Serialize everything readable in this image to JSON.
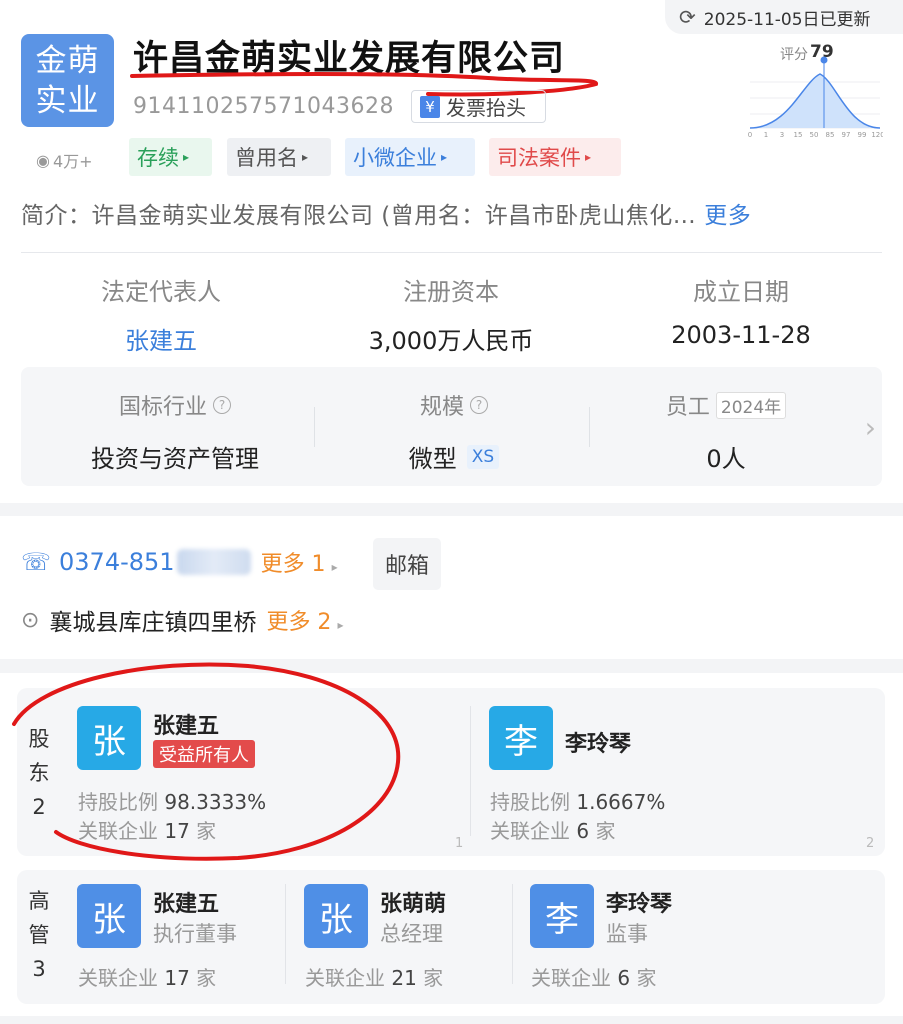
{
  "update": {
    "icon": "refresh-icon",
    "text": "2025-11-05日已更新"
  },
  "company": {
    "logo_line1": "金萌",
    "logo_line2": "实业",
    "name": "许昌金萌实业发展有限公司",
    "credit_code": "914110257571043628",
    "invoice_label": "发票抬头",
    "views": "4万+"
  },
  "score": {
    "label": "评分",
    "value": "79",
    "axis": [
      "0",
      "1",
      "3",
      "15",
      "50",
      "85",
      "97",
      "99",
      "120"
    ]
  },
  "tags": [
    {
      "label": "存续",
      "color": "#2aa05a"
    },
    {
      "label": "曾用名",
      "color": "#555555"
    },
    {
      "label": "小微企业",
      "color": "#3b7fdb"
    },
    {
      "label": "司法案件",
      "color": "#e04a4a"
    }
  ],
  "intro": {
    "prefix": "简介：",
    "text": "许昌金萌实业发展有限公司 (曾用名：许昌市卧虎山焦化…",
    "more": "更多"
  },
  "stats": [
    {
      "label": "法定代表人",
      "value": "张建五"
    },
    {
      "label": "注册资本",
      "value": "3,000万人民币"
    },
    {
      "label": "成立日期",
      "value": "2003-11-28"
    }
  ],
  "info": {
    "industry": {
      "label": "国标行业",
      "value": "投资与资产管理"
    },
    "scale": {
      "label": "规模",
      "value": "微型",
      "badge": "XS"
    },
    "staff": {
      "label": "员工",
      "year": "2024年",
      "value": "0人"
    }
  },
  "contact": {
    "phone": "0374-851",
    "phone_more": "更多 1",
    "email_label": "邮箱",
    "address": "襄城县库庄镇四里桥",
    "address_more": "更多 2"
  },
  "shareholders": {
    "side": [
      "股",
      "东",
      "2"
    ],
    "items": [
      {
        "avatar": "张",
        "name": "张建五",
        "badge": "受益所有人",
        "ratio_label": "持股比例",
        "ratio": "98.3333%",
        "rel_label": "关联企业",
        "rel_count": "17",
        "rel_unit": "家",
        "index": "1"
      },
      {
        "avatar": "李",
        "name": "李玲琴",
        "ratio_label": "持股比例",
        "ratio": "1.6667%",
        "rel_label": "关联企业",
        "rel_count": "6",
        "rel_unit": "家",
        "index": "2"
      }
    ]
  },
  "executives": {
    "side": [
      "高",
      "管",
      "3"
    ],
    "items": [
      {
        "avatar": "张",
        "name": "张建五",
        "role": "执行董事",
        "rel_label": "关联企业",
        "rel_count": "17",
        "rel_unit": "家"
      },
      {
        "avatar": "张",
        "name": "张萌萌",
        "role": "总经理",
        "rel_label": "关联企业",
        "rel_count": "21",
        "rel_unit": "家"
      },
      {
        "avatar": "李",
        "name": "李玲琴",
        "role": "监事",
        "rel_label": "关联企业",
        "rel_count": "6",
        "rel_unit": "家"
      }
    ]
  }
}
